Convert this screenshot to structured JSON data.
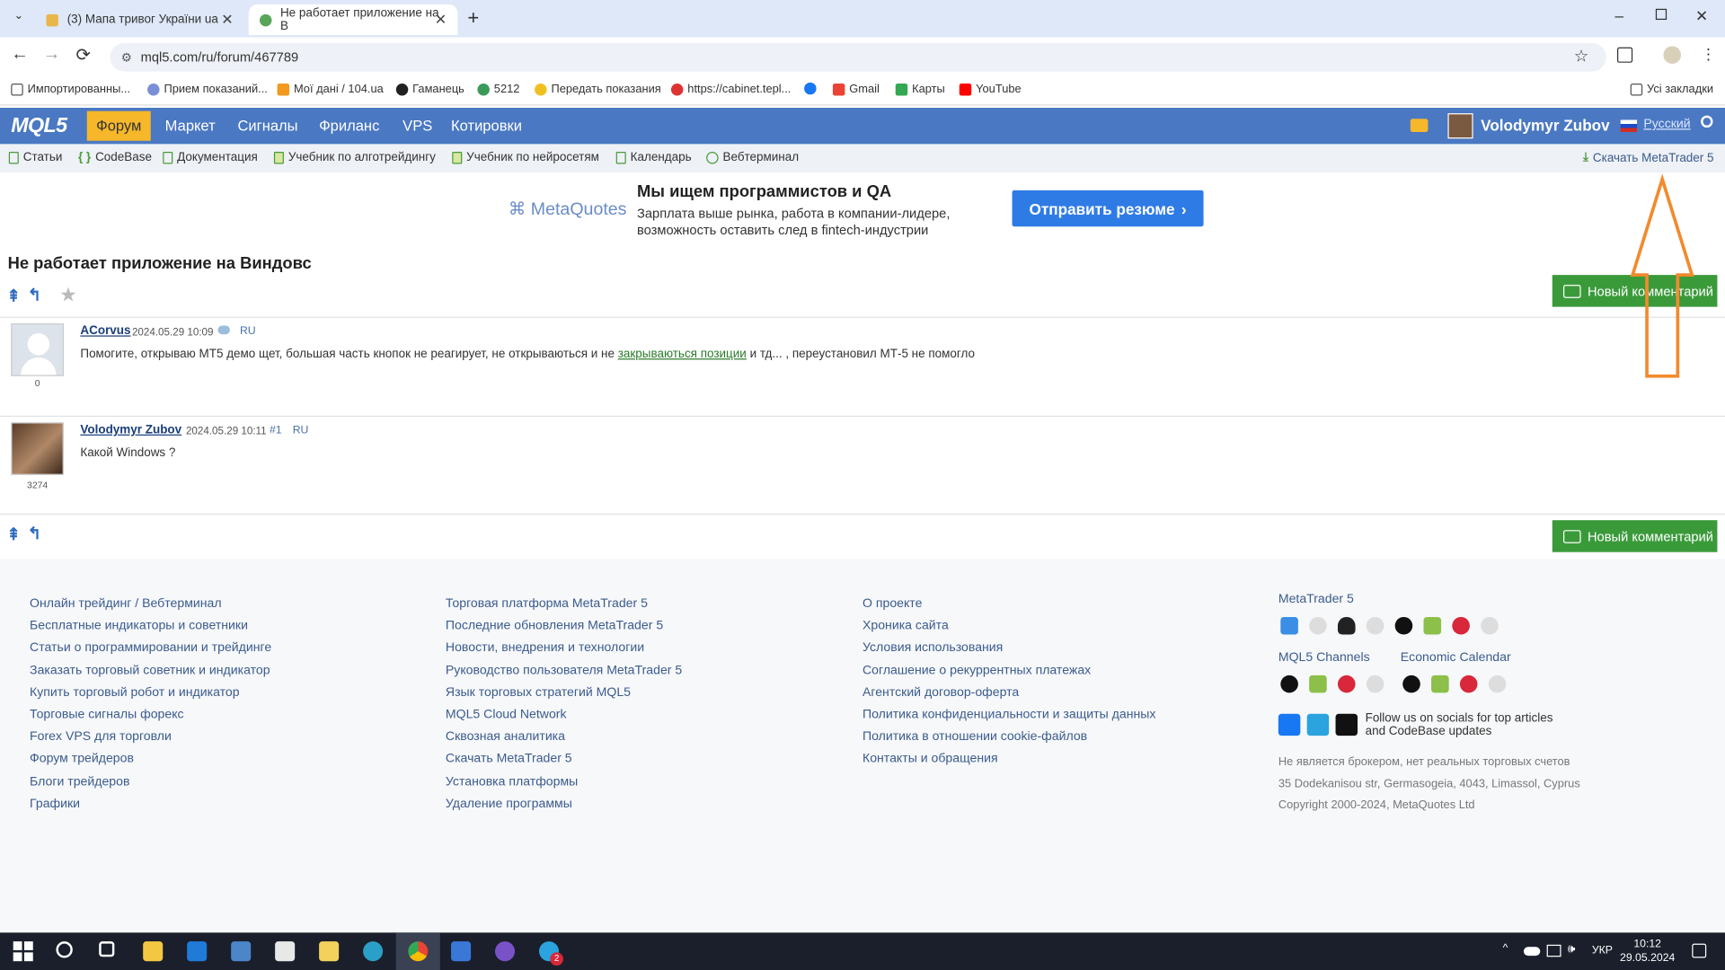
{
  "browser": {
    "tabs": [
      {
        "title": "(3) Мапа тривог України ua"
      },
      {
        "title": "Не работает приложение на В"
      }
    ],
    "url": "mql5.com/ru/forum/467789",
    "bookmarks": [
      "Импортированны...",
      "Прием показаний...",
      "Мої дані / 104.ua",
      "Гаманець",
      "5212",
      "Передать показания",
      "https://cabinet.tepl...",
      "Gmail",
      "Карты",
      "YouTube"
    ],
    "all_bookmarks": "Усі закладки"
  },
  "site": {
    "logo": "MQL5",
    "nav": [
      "Форум",
      "Маркет",
      "Сигналы",
      "Фриланс",
      "VPS",
      "Котировки"
    ],
    "user_name": "Volodymyr Zubov",
    "language": "Русский",
    "subnav": [
      "Статьи",
      "CodeBase",
      "Документация",
      "Учебник по алготрейдингу",
      "Учебник по нейросетям",
      "Календарь",
      "Вебтерминал"
    ],
    "download_label": "Скачать MetaTrader 5"
  },
  "banner": {
    "brand": "MetaQuotes",
    "headline": "Мы ищем программистов и QA",
    "line1": "Зарплата выше рынка, работа в компании-лидере,",
    "line2": "возможность оставить след в fintech-индустрии",
    "cta": "Отправить резюме"
  },
  "topic": {
    "title": "Не работает приложение на Виндовс",
    "new_comment_label": "Новый комментарий"
  },
  "posts": [
    {
      "author": "ACorvus",
      "date": "2024.05.29 10:09",
      "lang": "RU",
      "rating": "0",
      "text_before": "Помогите, открываю МТ5 демо щет, большая часть кнопок не реагирует, не открываються и не",
      "link": "закрываються позиции",
      "text_after": "и тд... , переустановил МТ-5 не помогло"
    },
    {
      "author": "Volodymyr Zubov",
      "date": "2024.05.29 10:11",
      "number": "#1",
      "lang": "RU",
      "rating": "3274",
      "text": "Какой Windows ?"
    }
  ],
  "footer": {
    "col1": [
      "Онлайн трейдинг / Вебтерминал",
      "Бесплатные индикаторы и советники",
      "Статьи о программировании и трейдинге",
      "Заказать торговый советник и индикатор",
      "Купить торговый робот и индикатор",
      "Торговые сигналы форекс",
      "Forex VPS для торговли",
      "Форум трейдеров",
      "Блоги трейдеров",
      "Графики"
    ],
    "col2": [
      "Торговая платформа MetaTrader 5",
      "Последние обновления MetaTrader 5",
      "Новости, внедрения и технологии",
      "Руководство пользователя MetaTrader 5",
      "Язык торговых стратегий MQL5",
      "MQL5 Cloud Network",
      "Сквозная аналитика",
      "Скачать MetaTrader 5",
      "Установка платформы",
      "Удаление программы"
    ],
    "col3": [
      "О проекте",
      "Хроника сайта",
      "Условия использования",
      "Соглашение о рекуррентных платежах",
      "Агентский договор-оферта",
      "Политика конфиденциальности и защиты данных",
      "Политика в отношении cookie-файлов",
      "Контакты и обращения"
    ],
    "mt5_title": "MetaTrader 5",
    "channels_title": "MQL5 Channels",
    "calendar_title": "Economic Calendar",
    "follow_line1": "Follow us on socials for top articles",
    "follow_line2": "and CodeBase updates",
    "disclaimer": "Не является брокером, нет реальных торговых счетов",
    "address": "35 Dodekanisou str, Germasogeia, 4043, Limassol, Cyprus",
    "copyright": "Copyright 2000-2024, MetaQuotes Ltd"
  },
  "taskbar": {
    "lang": "УКР",
    "time": "10:12",
    "date": "29.05.2024",
    "badge": "2"
  },
  "colors": {
    "nav_blue": "#4a78c2",
    "nav_active": "#f6b72a",
    "green_button": "#3a9a3a",
    "annotation_arrow": "#f28a2e"
  }
}
